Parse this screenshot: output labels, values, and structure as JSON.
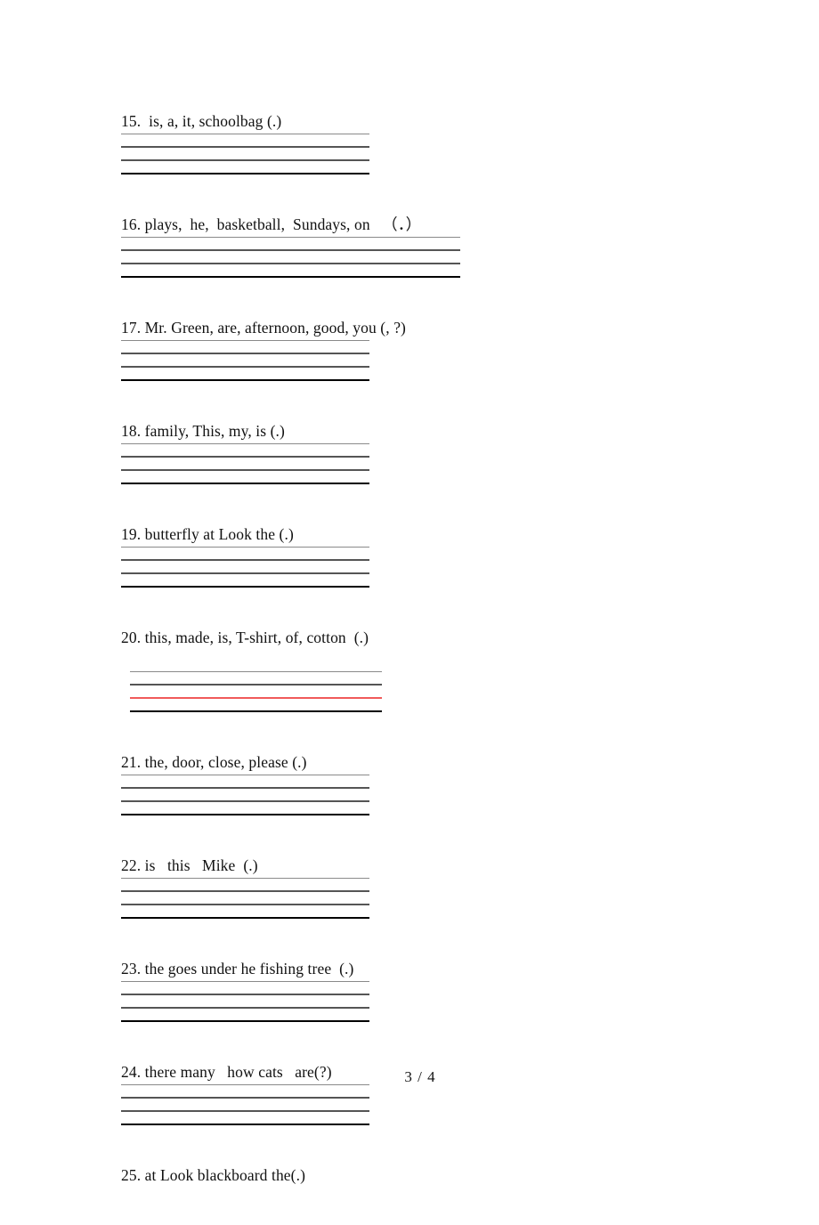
{
  "document": {
    "type": "worksheet",
    "footer_page_label": "3 / 4"
  },
  "items": [
    {
      "number": "15.",
      "prompt": "15.  is, a, it, schoolbag (.)",
      "line_width": 279,
      "line_indent": 0,
      "leading_underline": true,
      "red_rule_index": null,
      "rule_count": 4
    },
    {
      "number": "16.",
      "prompt": "16. plays,  he,  basketball,  Sundays, on   （．）",
      "line_width": 381,
      "line_indent": 0,
      "leading_underline": true,
      "red_rule_index": null,
      "rule_count": 4
    },
    {
      "number": "17.",
      "prompt": "17. Mr. Green, are, afternoon, good, you (, ?)",
      "line_width": 279,
      "line_indent": 0,
      "leading_underline": true,
      "red_rule_index": null,
      "rule_count": 4
    },
    {
      "number": "18.",
      "prompt": "18. family, This, my, is (.)",
      "line_width": 279,
      "line_indent": 0,
      "leading_underline": true,
      "red_rule_index": null,
      "rule_count": 4
    },
    {
      "number": "19.",
      "prompt": "19. butterfly at Look the (.)",
      "line_width": 279,
      "line_indent": 0,
      "leading_underline": true,
      "red_rule_index": null,
      "rule_count": 4
    },
    {
      "number": "20.",
      "prompt": "20. this, made, is, T-shirt, of, cotton  (.)",
      "line_width": 283,
      "line_indent": 10,
      "leading_underline": false,
      "red_rule_index": 3,
      "rule_count": 4
    },
    {
      "number": "21.",
      "prompt": "21. the, door, close, please (.)",
      "line_width": 279,
      "line_indent": 0,
      "leading_underline": true,
      "red_rule_index": null,
      "rule_count": 4
    },
    {
      "number": "22.",
      "prompt": "22. is   this   Mike  (.)",
      "line_width": 279,
      "line_indent": 0,
      "leading_underline": true,
      "red_rule_index": null,
      "rule_count": 4
    },
    {
      "number": "23.",
      "prompt": "23. the goes under he fishing tree  (.)",
      "line_width": 279,
      "line_indent": 0,
      "leading_underline": true,
      "red_rule_index": null,
      "rule_count": 4
    },
    {
      "number": "24.",
      "prompt": "24. there many   how cats   are(?)",
      "line_width": 279,
      "line_indent": 0,
      "leading_underline": true,
      "red_rule_index": null,
      "rule_count": 4
    },
    {
      "number": "25.",
      "prompt": "25. at Look blackboard the(.)",
      "line_width": 0,
      "line_indent": 0,
      "leading_underline": false,
      "red_rule_index": null,
      "rule_count": 0
    }
  ],
  "colors": {
    "page_background": "#ffffff",
    "text": "#111111",
    "rule_light": "#8a8a8a",
    "rule_medium": "#555555",
    "rule_heavy": "#000000",
    "rule_red": "#f05a5a"
  }
}
